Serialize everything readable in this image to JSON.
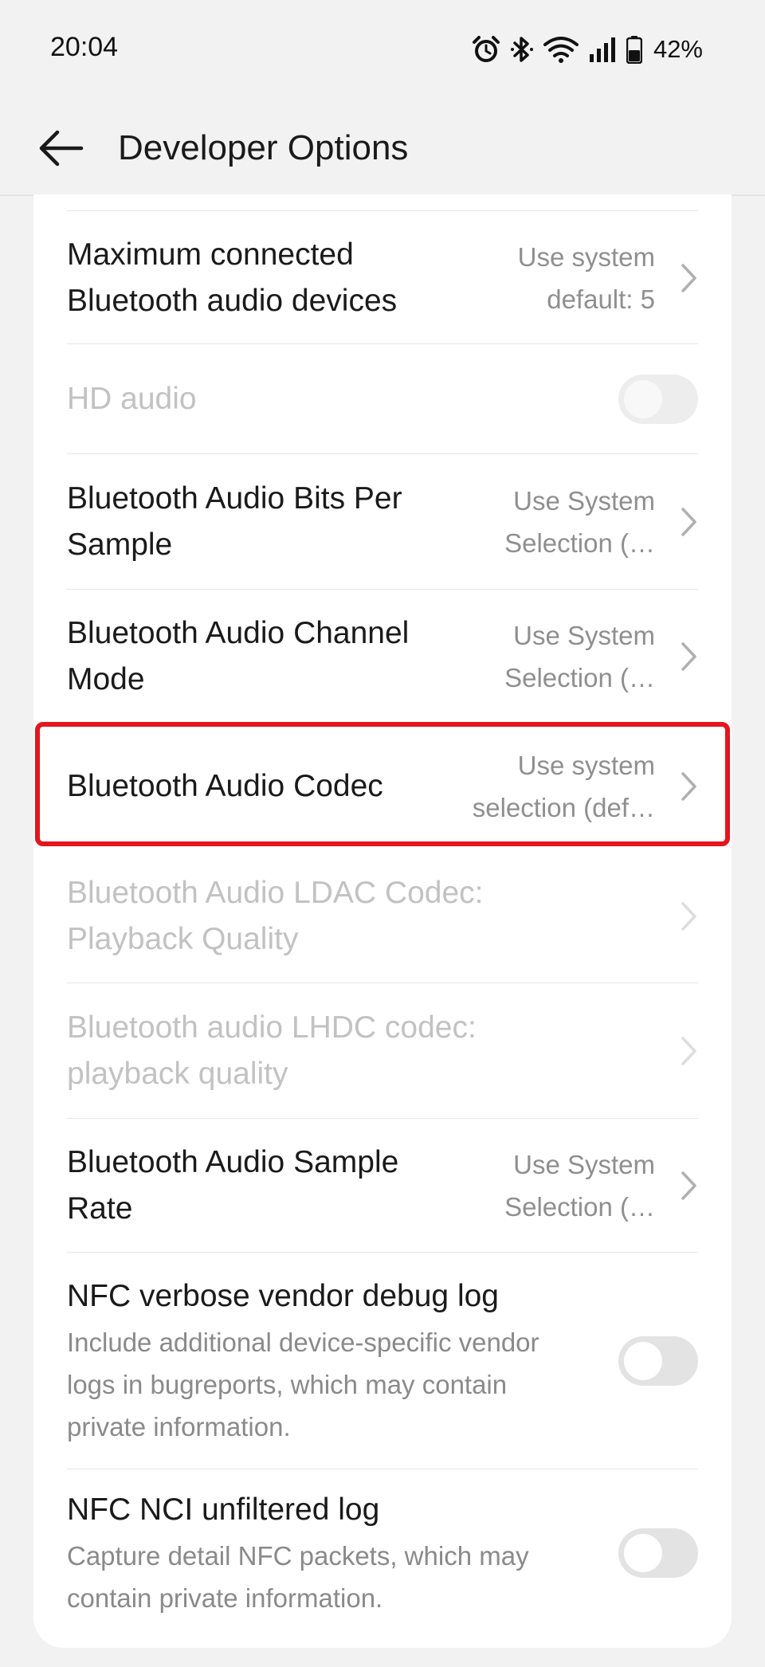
{
  "status_bar": {
    "time": "20:04",
    "battery": "42%",
    "icons": [
      "alarm-icon",
      "bluetooth-icon",
      "wifi-icon",
      "signal-icon",
      "battery-icon"
    ]
  },
  "app_bar": {
    "title": "Developer Options",
    "back_icon": "arrow-left-icon"
  },
  "settings": {
    "max_bt_devices": {
      "title": "Maximum connected Bluetooth audio devices",
      "value": "Use system default: 5"
    },
    "hd_audio": {
      "title": "HD audio",
      "enabled": false,
      "checked": false
    },
    "bits_per_sample": {
      "title": "Bluetooth Audio Bits Per Sample",
      "value": "Use System Selection (…"
    },
    "channel_mode": {
      "title": "Bluetooth Audio Channel Mode",
      "value": "Use System Selection (…"
    },
    "codec": {
      "title": "Bluetooth Audio Codec",
      "value": "Use system selection (def…",
      "highlighted": true
    },
    "ldac": {
      "title": "Bluetooth Audio LDAC Codec: Playback Quality",
      "enabled": false
    },
    "lhdc": {
      "title": "Bluetooth audio LHDC codec: playback quality",
      "enabled": false
    },
    "sample_rate": {
      "title": "Bluetooth Audio Sample Rate",
      "value": "Use System Selection (…"
    },
    "nfc_verbose": {
      "title": "NFC verbose vendor debug log",
      "subtitle": "Include additional device-specific vendor logs in bugreports, which may contain private information.",
      "checked": false
    },
    "nfc_nci": {
      "title": "NFC NCI unfiltered log",
      "subtitle": "Capture detail NFC packets, which may contain private information.",
      "checked": false
    }
  },
  "colors": {
    "highlight": "#e3161e",
    "background": "#f2f2f2",
    "card": "#ffffff",
    "disabled_text": "#c2c2c2"
  }
}
